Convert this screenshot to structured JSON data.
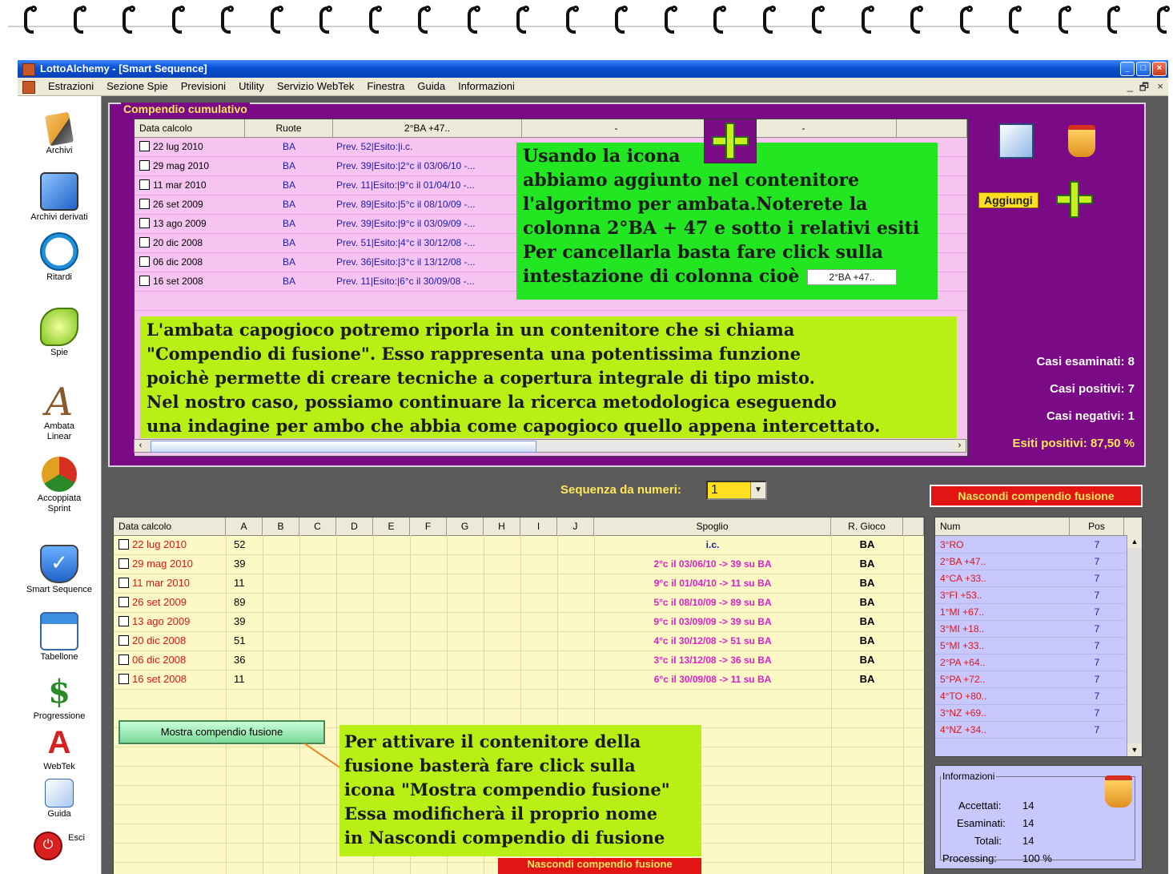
{
  "window": {
    "title": "LottoAlchemy - [Smart Sequence]",
    "controls": [
      "_",
      "□",
      "×"
    ]
  },
  "menubar": {
    "items": [
      "Estrazioni",
      "Sezione Spie",
      "Previsioni",
      "Utility",
      "Servizio WebTek",
      "Finestra",
      "Guida",
      "Informazioni"
    ],
    "mdi_controls": [
      "_",
      "🗗",
      "×"
    ]
  },
  "sidebar": {
    "items": [
      {
        "label": "Archivi",
        "icon": "pencil-icon"
      },
      {
        "label": "Archivi derivati",
        "icon": "archive-box-icon"
      },
      {
        "label": "Ritardi",
        "icon": "clock-icon"
      },
      {
        "label": "Spie",
        "icon": "flashlight-icon"
      },
      {
        "label": "Ambata Linear",
        "icon": "letter-a-icon"
      },
      {
        "label": "Accoppiata Sprint",
        "icon": "recycle-arrows-icon"
      },
      {
        "label": "Smart Sequence",
        "icon": "shield-check-icon"
      },
      {
        "label": "Tabellone",
        "icon": "calendar-icon"
      },
      {
        "label": "Progressione",
        "icon": "dollar-icon"
      },
      {
        "label": "WebTek",
        "icon": "webtek-icon"
      },
      {
        "label": "Guida",
        "icon": "guide-icon"
      },
      {
        "label": "Esci",
        "icon": "exit-icon"
      }
    ]
  },
  "compendio": {
    "legend": "Compendio cumulativo",
    "headers": [
      "Data calcolo",
      "Ruote",
      "2°BA +47..",
      "-",
      "-"
    ],
    "rows": [
      {
        "date": "22 lug 2010",
        "ruota": "BA",
        "prev": "Prev. 52|Esito:|i.c."
      },
      {
        "date": "29 mag 2010",
        "ruota": "BA",
        "prev": "Prev. 39|Esito:|2°c il 03/06/10 -..."
      },
      {
        "date": "11 mar 2010",
        "ruota": "BA",
        "prev": "Prev. 11|Esito:|9°c il 01/04/10 -..."
      },
      {
        "date": "26 set 2009",
        "ruota": "BA",
        "prev": "Prev. 89|Esito:|5°c il 08/10/09 -..."
      },
      {
        "date": "13 ago 2009",
        "ruota": "BA",
        "prev": "Prev. 39|Esito:|9°c il 03/09/09 -..."
      },
      {
        "date": "20 dic 2008",
        "ruota": "BA",
        "prev": "Prev. 51|Esito:|4°c il 30/12/08 -..."
      },
      {
        "date": "06 dic 2008",
        "ruota": "BA",
        "prev": "Prev. 36|Esito:|3°c il 13/12/08 -..."
      },
      {
        "date": "16 set 2008",
        "ruota": "BA",
        "prev": "Prev. 11|Esito:|6°c il 30/09/08 -..."
      }
    ],
    "add_label": "Aggiungi",
    "stats": {
      "esaminati": "Casi esaminati: 8",
      "positivi": "Casi positivi: 7",
      "negativi": "Casi negativi: 1",
      "esiti": "Esiti positivi: 87,50 %"
    }
  },
  "callout_green": {
    "lines": [
      "Usando la icona",
      "abbiamo aggiunto nel contenitore",
      "l'algoritmo per ambata.Noterete la",
      "colonna 2°BA + 47 e sotto i relativi esiti",
      "Per cancellarla basta fare click sulla",
      "intestazione di colonna cioè"
    ],
    "column_chip": "2°BA +47.."
  },
  "callout_lime": {
    "lines": [
      "L'ambata capogioco potremo riporla in un contenitore che si chiama",
      "\"Compendio di fusione\". Esso rappresenta una potentissima funzione",
      "poichè permette di creare tecniche a copertura  integrale di tipo misto.",
      "Nel nostro caso, possiamo continuare la ricerca metodologica eseguendo",
      "una indagine per ambo che abbia come capogioco quello appena intercettato."
    ]
  },
  "sequence": {
    "label": "Sequenza da numeri:",
    "value": "1"
  },
  "hide_fusion_button": "Nascondi compendio fusione",
  "main_grid": {
    "headers": [
      "Data calcolo",
      "A",
      "B",
      "C",
      "D",
      "E",
      "F",
      "G",
      "H",
      "I",
      "J",
      "Spoglio",
      "R. Gioco"
    ],
    "rows": [
      {
        "date": "22 lug 2010",
        "a": "52",
        "spoglio": "i.c.",
        "gioco": "BA"
      },
      {
        "date": "29 mag 2010",
        "a": "39",
        "spoglio": "2°c il 03/06/10 -> 39 su BA",
        "gioco": "BA"
      },
      {
        "date": "11 mar 2010",
        "a": "11",
        "spoglio": "9°c il 01/04/10 -> 11 su BA",
        "gioco": "BA"
      },
      {
        "date": "26 set 2009",
        "a": "89",
        "spoglio": "5°c il 08/10/09 -> 89 su BA",
        "gioco": "BA"
      },
      {
        "date": "13 ago 2009",
        "a": "39",
        "spoglio": "9°c il 03/09/09 -> 39 su BA",
        "gioco": "BA"
      },
      {
        "date": "20 dic 2008",
        "a": "51",
        "spoglio": "4°c il 30/12/08 -> 51 su BA",
        "gioco": "BA"
      },
      {
        "date": "06 dic 2008",
        "a": "36",
        "spoglio": "3°c il 13/12/08 -> 36 su BA",
        "gioco": "BA"
      },
      {
        "date": "16 set 2008",
        "a": "11",
        "spoglio": "6°c il 30/09/08 -> 11 su BA",
        "gioco": "BA"
      }
    ],
    "show_button": "Mostra compendio fusione"
  },
  "callout_bottom": {
    "lines": [
      "Per attivare il contenitore della",
      "fusione basterà fare click sulla",
      "icona \"Mostra compendio fusione\"",
      "Essa modificherà il proprio nome",
      "in Nascondi compendio di fusione"
    ]
  },
  "side_list": {
    "headers": [
      "Num",
      "Pos"
    ],
    "rows": [
      {
        "num": "3°RO",
        "pos": "7"
      },
      {
        "num": "2°BA +47..",
        "pos": "7"
      },
      {
        "num": "4°CA +33..",
        "pos": "7"
      },
      {
        "num": "3°FI +53..",
        "pos": "7"
      },
      {
        "num": "1°MI +67..",
        "pos": "7"
      },
      {
        "num": "3°MI +18..",
        "pos": "7"
      },
      {
        "num": "5°MI +33..",
        "pos": "7"
      },
      {
        "num": "2°PA +64..",
        "pos": "7"
      },
      {
        "num": "5°PA +72..",
        "pos": "7"
      },
      {
        "num": "4°TO +80..",
        "pos": "7"
      },
      {
        "num": "3°NZ +69..",
        "pos": "7"
      },
      {
        "num": "4°NZ +34..",
        "pos": "7"
      }
    ]
  },
  "info": {
    "legend": "Informazioni",
    "accettati_label": "Accettati:",
    "accettati": "14",
    "esaminati_label": "Esaminati:",
    "esaminati": "14",
    "totali_label": "Totali:",
    "totali": "14",
    "processing_label": "Processing:",
    "processing": "100 %"
  },
  "colors": {
    "purple_panel": "#7a0a86",
    "pink_grid": "#f7c4f2",
    "yellow_grid": "#fdf9c4",
    "red_text": "#e31414",
    "magenta_text": "#e020c8",
    "blue_text": "#1a1ab0",
    "callout_green": "#22e622",
    "callout_lime": "#b8ef14"
  }
}
